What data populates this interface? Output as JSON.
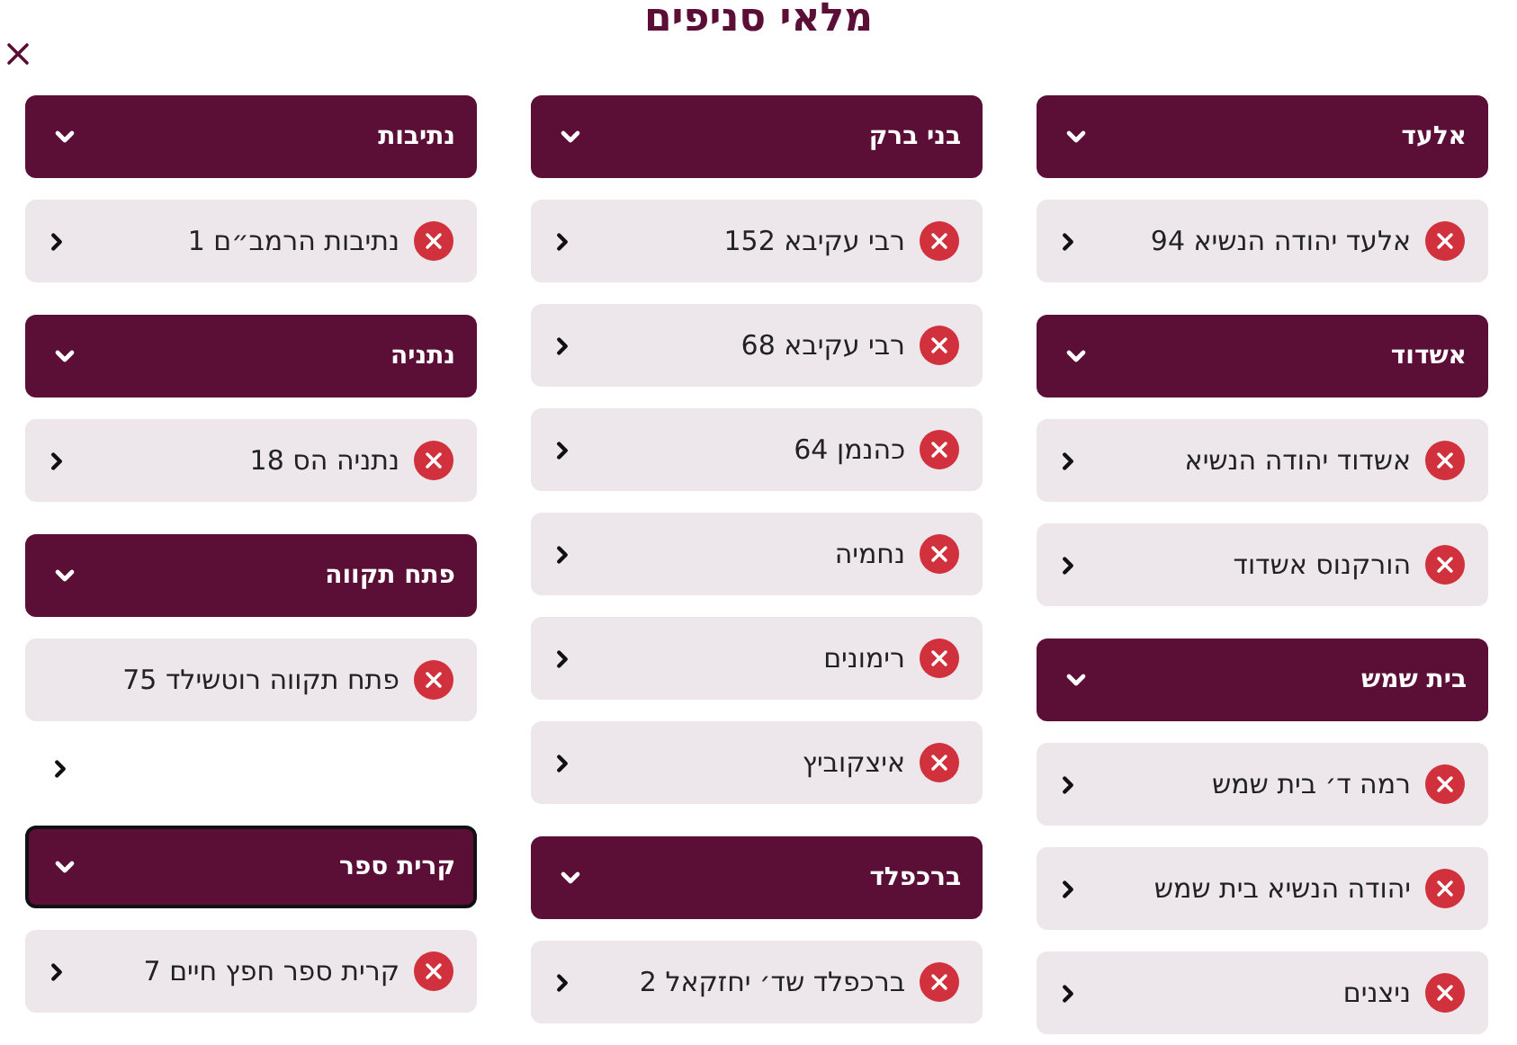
{
  "title": "מלאי סניפים",
  "columns": [
    {
      "groups": [
        {
          "name": "אלעד",
          "focused": false,
          "items": [
            {
              "label": "אלעד יהודה הנשיא 94",
              "chevron_outside": false
            }
          ]
        },
        {
          "name": "אשדוד",
          "focused": false,
          "items": [
            {
              "label": "אשדוד יהודה הנשיא",
              "chevron_outside": false
            },
            {
              "label": "הורקנוס אשדוד",
              "chevron_outside": false
            }
          ]
        },
        {
          "name": "בית שמש",
          "focused": false,
          "items": [
            {
              "label": "רמה ד׳ בית שמש",
              "chevron_outside": false
            },
            {
              "label": "יהודה הנשיא בית שמש",
              "chevron_outside": false
            },
            {
              "label": "ניצנים",
              "chevron_outside": false
            }
          ]
        }
      ]
    },
    {
      "groups": [
        {
          "name": "בני ברק",
          "focused": false,
          "items": [
            {
              "label": "רבי עקיבא 152",
              "chevron_outside": false
            },
            {
              "label": "רבי עקיבא 68",
              "chevron_outside": false
            },
            {
              "label": "כהנמן 64",
              "chevron_outside": false
            },
            {
              "label": "נחמיה",
              "chevron_outside": false
            },
            {
              "label": "רימונים",
              "chevron_outside": false
            },
            {
              "label": "איצקוביץ",
              "chevron_outside": false
            }
          ]
        },
        {
          "name": "ברכפלד",
          "focused": false,
          "items": [
            {
              "label": "ברכפלד שד׳ יחזקאל 2",
              "chevron_outside": false
            }
          ]
        }
      ]
    },
    {
      "groups": [
        {
          "name": "נתיבות",
          "focused": false,
          "items": [
            {
              "label": "נתיבות הרמב״ם 1",
              "chevron_outside": false
            }
          ]
        },
        {
          "name": "נתניה",
          "focused": false,
          "items": [
            {
              "label": "נתניה הס 18",
              "chevron_outside": false
            }
          ]
        },
        {
          "name": "פתח תקווה",
          "focused": false,
          "items": [
            {
              "label": "פתח תקווה רוטשילד 75",
              "chevron_outside": true
            }
          ]
        },
        {
          "name": "קרית ספר",
          "focused": true,
          "items": [
            {
              "label": "קרית ספר חפץ חיים 7",
              "chevron_outside": false
            }
          ]
        }
      ]
    }
  ]
}
